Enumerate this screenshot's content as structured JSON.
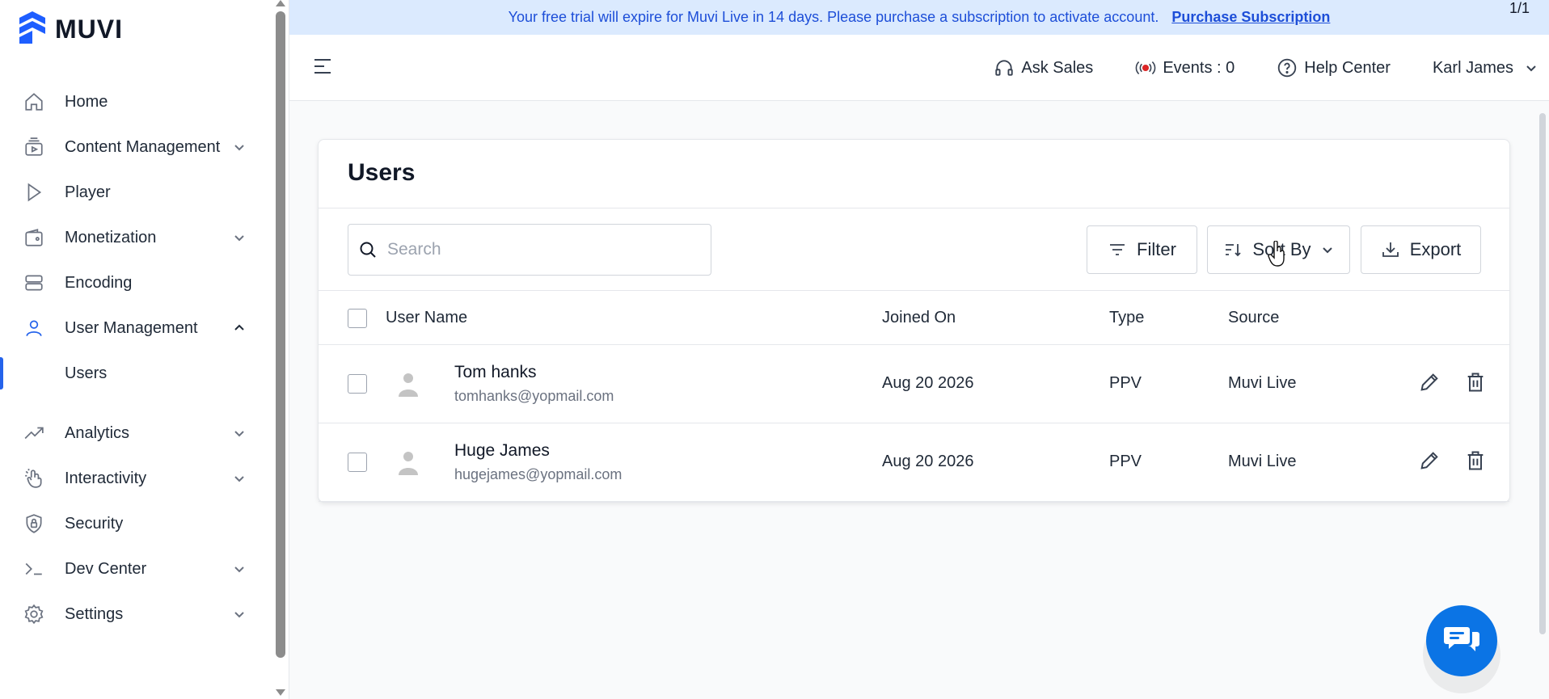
{
  "brand": {
    "name": "MUVI"
  },
  "banner": {
    "message": "Your free trial will expire for Muvi Live in 14 days. Please purchase a subscription to activate account.",
    "link": "Purchase Subscription",
    "page_count": "1/1"
  },
  "topbar": {
    "ask_sales": "Ask Sales",
    "events": "Events : 0",
    "help_center": "Help Center",
    "user_name": "Karl James"
  },
  "sidebar": {
    "items": [
      {
        "label": "Home",
        "icon": "home-icon"
      },
      {
        "label": "Content Management",
        "icon": "content-icon"
      },
      {
        "label": "Player",
        "icon": "play-icon"
      },
      {
        "label": "Monetization",
        "icon": "wallet-icon"
      },
      {
        "label": "Encoding",
        "icon": "server-icon"
      },
      {
        "label": "User Management",
        "icon": "user-icon"
      },
      {
        "label": "Users"
      },
      {
        "label": "Analytics",
        "icon": "trend-icon"
      },
      {
        "label": "Interactivity",
        "icon": "interactivity-icon"
      },
      {
        "label": "Security",
        "icon": "shield-icon"
      },
      {
        "label": "Dev Center",
        "icon": "terminal-icon"
      },
      {
        "label": "Settings",
        "icon": "gear-icon"
      }
    ]
  },
  "page": {
    "title": "Users",
    "search_placeholder": "Search",
    "filter_label": "Filter",
    "sort_label": "Sort By",
    "export_label": "Export"
  },
  "table": {
    "headers": [
      "User Name",
      "Joined On",
      "Type",
      "Source"
    ],
    "rows": [
      {
        "name": "Tom hanks",
        "email": "tomhanks@yopmail.com",
        "joined": "Aug 20 2026",
        "type": "PPV",
        "source": "Muvi Live"
      },
      {
        "name": "Huge James",
        "email": "hugejames@yopmail.com",
        "joined": "Aug 20 2026",
        "type": "PPV",
        "source": "Muvi Live"
      }
    ]
  },
  "colors": {
    "accent": "#2563eb",
    "banner_bg": "#dbeafe",
    "fab": "#0b74e5"
  }
}
